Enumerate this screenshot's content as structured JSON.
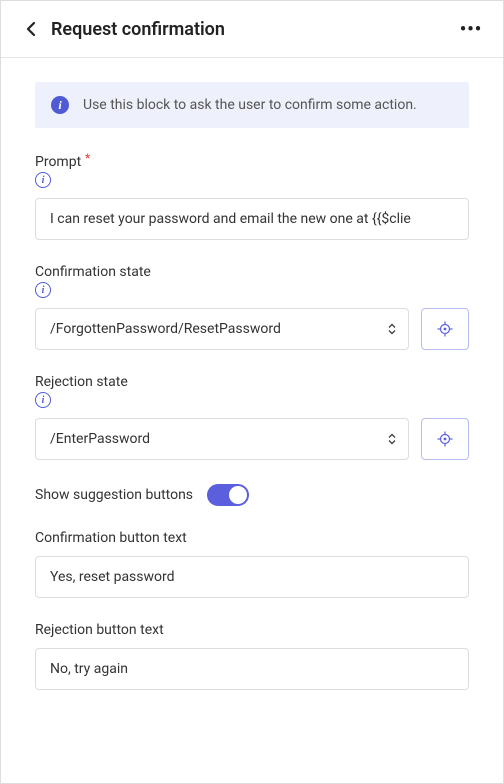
{
  "header": {
    "title": "Request confirmation"
  },
  "banner": {
    "text": "Use this block to ask the user to confirm some action."
  },
  "prompt": {
    "label": "Prompt",
    "value": "I can reset your password and email the new one at {{$clie"
  },
  "confirmationState": {
    "label": "Confirmation state",
    "value": "/ForgottenPassword/ResetPassword"
  },
  "rejectionState": {
    "label": "Rejection state",
    "value": "/EnterPassword"
  },
  "showSuggestion": {
    "label": "Show suggestion buttons",
    "on": true
  },
  "confirmButton": {
    "label": "Confirmation button text",
    "value": "Yes, reset password"
  },
  "rejectButton": {
    "label": "Rejection button text",
    "value": "No, try again"
  }
}
